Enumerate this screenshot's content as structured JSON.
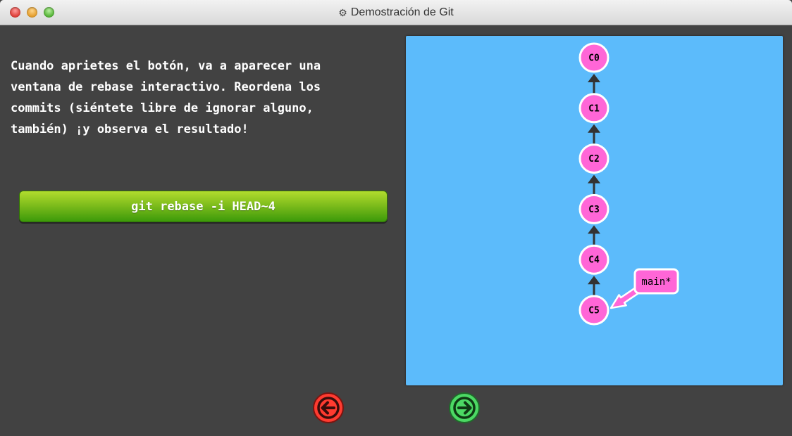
{
  "window": {
    "title": "Demostración de Git",
    "title_icon": "gear-icon"
  },
  "instructions": {
    "lines": [
      "Cuando aprietes el botón, va a aparecer una",
      "ventana de rebase interactivo. Reordena los",
      "commits (siéntete libre de ignorar alguno,",
      "también) ¡y observa el resultado!"
    ]
  },
  "command_button": {
    "label": "git rebase -i HEAD~4"
  },
  "graph": {
    "commits": [
      "C0",
      "C1",
      "C2",
      "C3",
      "C4",
      "C5"
    ],
    "branch": {
      "label": "main*",
      "target": "C5"
    },
    "colors": {
      "background": "#5cbbfb",
      "commit_fill": "#ff66d7",
      "branch_fill": "#ff66d7",
      "edge": "#333333"
    }
  },
  "navigation": {
    "prev": {
      "icon": "arrow-left-icon",
      "color": "#ff3b30"
    },
    "next": {
      "icon": "arrow-right-icon",
      "color": "#4cd964"
    }
  }
}
